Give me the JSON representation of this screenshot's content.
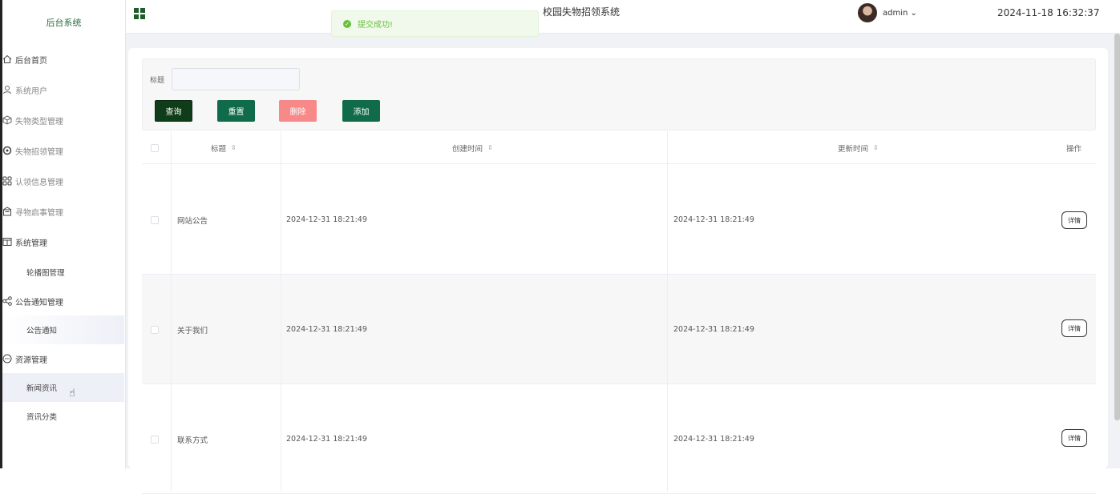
{
  "sidebar": {
    "logo": "后台系统",
    "items": [
      {
        "label": "后台首页",
        "icon": "home-icon"
      },
      {
        "label": "系统用户",
        "icon": "user-icon"
      },
      {
        "label": "失物类型管理",
        "icon": "cube-icon"
      },
      {
        "label": "失物招领管理",
        "icon": "gear-icon"
      },
      {
        "label": "认领信息管理",
        "icon": "grid-icon"
      },
      {
        "label": "寻物启事管理",
        "icon": "building-icon"
      },
      {
        "label": "系统管理",
        "icon": "window-icon"
      },
      {
        "label": "轮播图管理",
        "icon": ""
      },
      {
        "label": "公告通知管理",
        "icon": "share-icon"
      },
      {
        "label": "公告通知",
        "icon": ""
      },
      {
        "label": "资源管理",
        "icon": "chat-icon"
      },
      {
        "label": "新闻资讯",
        "icon": ""
      },
      {
        "label": "资讯分类",
        "icon": ""
      }
    ]
  },
  "header": {
    "site_title": "校园失物招领系统",
    "toast": "提交成功!",
    "username": "admin",
    "clock": "2024-11-18 16:32:37"
  },
  "search": {
    "title_label": "标题",
    "title_value": ""
  },
  "toolbar": {
    "query": "查询",
    "reset": "重置",
    "delete": "删除",
    "add": "添加"
  },
  "table": {
    "headers": [
      "标题",
      "创建时间",
      "更新时间",
      "操作"
    ],
    "sort_icon": "⇕",
    "rows": [
      {
        "title": "网站公告",
        "created": "2024-12-31 18:21:49",
        "updated": "2024-12-31 18:21:49",
        "action": "详情"
      },
      {
        "title": "关于我们",
        "created": "2024-12-31 18:21:49",
        "updated": "2024-12-31 18:21:49",
        "action": "详情"
      },
      {
        "title": "联系方式",
        "created": "2024-12-31 18:21:49",
        "updated": "2024-12-31 18:21:49",
        "action": "详情"
      }
    ]
  },
  "colors": {
    "primary_green": "#0f6b4a",
    "query_dark": "#0f3d1a",
    "delete_red": "#f78989",
    "toast_green": "#67c23a"
  }
}
